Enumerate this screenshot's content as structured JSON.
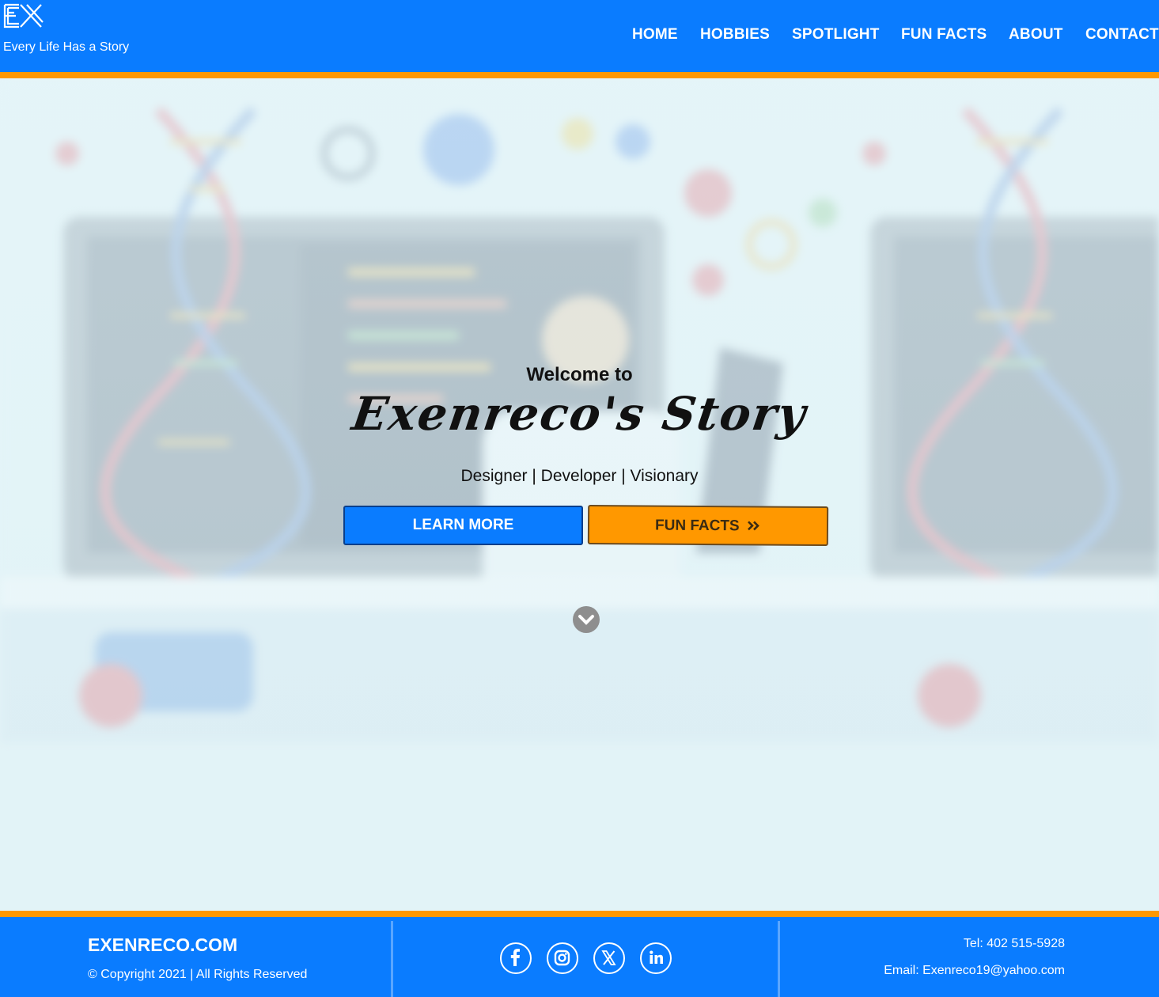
{
  "header": {
    "logo_text": "EX",
    "tagline": "Every Life Has a Story",
    "nav": [
      "HOME",
      "HOBBIES",
      "SPOTLIGHT",
      "FUN FACTS",
      "ABOUT",
      "CONTACT"
    ]
  },
  "hero": {
    "welcome": "Welcome to",
    "title": "Exenreco's Story",
    "subtitle": "Designer | Developer | Visionary",
    "learn_more_label": "LEARN MORE",
    "fun_facts_label": "FUN FACTS",
    "scroll_icon": "chevron-down-icon"
  },
  "footer": {
    "brand": "EXENRECO.COM",
    "copyright": "© Copyright 2021 | All Rights Reserved",
    "social": [
      "facebook-icon",
      "instagram-icon",
      "x-icon",
      "linkedin-icon"
    ],
    "tel": "Tel: 402 515-5928",
    "email": "Email: Exenreco19@yahoo.com"
  },
  "colors": {
    "primary_blue": "#0a7cff",
    "accent_orange": "#ff9800",
    "background": "#e3f3f7"
  }
}
